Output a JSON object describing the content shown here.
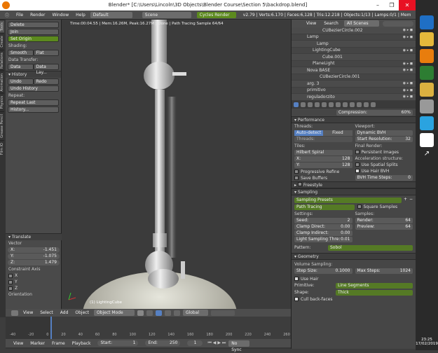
{
  "window": {
    "title": "Blender* [C:\\Users\\Lincoln\\3D Objects\\Blender Course\\Section 5\\backdrop.blend]"
  },
  "menubar": {
    "items": [
      "File",
      "Render",
      "Window",
      "Help"
    ],
    "layout": "Default",
    "scene": "Scene",
    "engine": "Cycles Render",
    "stats": "v2.79 | Verts:6.170 | Faces:6,128 | Tris:12.218 | Objects:1/13 | Lamps:0/1 | Mem"
  },
  "left_tabs": [
    "Tools",
    "Create",
    "Relations",
    "Animation",
    "Physics",
    "Grease Pencil",
    "Film IO"
  ],
  "tools": {
    "delete": "Delete",
    "join": "Join",
    "set_origin": "Set Origin",
    "shading_label": "Shading:",
    "smooth": "Smooth",
    "flat": "Flat",
    "data_transfer_label": "Data Transfer:",
    "data": "Data",
    "data_lay": "Data Lay...",
    "history_hd": "History",
    "undo": "Undo",
    "redo": "Redo",
    "undo_history": "Undo History",
    "repeat_label": "Repeat:",
    "repeat_last": "Repeat Last",
    "history": "History..."
  },
  "translate": {
    "hd": "Translate",
    "vector_label": "Vector",
    "x_label": "X:",
    "x": "-1.451",
    "y_label": "Y:",
    "y": "-1.075",
    "z_label": "Z:",
    "z": "1.479",
    "constraint_label": "Constraint Axis",
    "cx": "X",
    "cy": "Y",
    "cz": "Z",
    "orientation": "Orientation"
  },
  "viewport": {
    "info": "Time:00:04.55 | Mem:16.26M, Peak:16.27M | Done | Path Tracing Sample 64/64",
    "object": "(1) LightingCube"
  },
  "viewport_header": {
    "view": "View",
    "select": "Select",
    "add": "Add",
    "object": "Object",
    "mode": "Object Mode",
    "orientation": "Global"
  },
  "timeline": {
    "numbers": [
      "-40",
      "-20",
      "0",
      "20",
      "40",
      "60",
      "80",
      "100",
      "120",
      "140",
      "160",
      "180",
      "200",
      "220",
      "240",
      "260"
    ],
    "view": "View",
    "marker": "Marker",
    "frame": "Frame",
    "playback": "Playback",
    "start_label": "Start:",
    "start": "1",
    "end_label": "End:",
    "end": "250",
    "current": "1",
    "sync": "No Sync"
  },
  "outliner": {
    "view": "View",
    "search": "Search",
    "scenes": "All Scenes",
    "items": [
      "CUBezierCircle.002",
      "Lamp",
      "Lamp",
      "LightingCube",
      "Cube.001",
      "PlaneLight",
      "Nova BASE",
      "CUBezierCircle.001",
      "arg. 3",
      "primitivo",
      "reguladorzito"
    ]
  },
  "properties": {
    "compression_label": "Compression:",
    "compression": "60%",
    "performance_hd": "Performance",
    "threads_label": "Threads:",
    "auto_detect": "Auto-detect",
    "fixed": "Fixed",
    "threads": "Threads:",
    "viewport_label": "Viewport:",
    "viewport_bvh": "Dynamic BVH",
    "start_res_label": "Start Resolution:",
    "start_res": "32",
    "tiles_label": "Tiles:",
    "tiles": "Hilbert Spiral",
    "tx_label": "X:",
    "tx": "128",
    "ty_label": "Y:",
    "ty": "128",
    "final_render_label": "Final Render:",
    "persistent": "Persistent Images",
    "progressive": "Progressive Refine",
    "save_buffers": "Save Buffers",
    "accel_label": "Acceleration structure:",
    "spatial": "Use Spatial Splits",
    "hair_bvh": "Use Hair BVH",
    "bvh_steps_label": "BVH Time Steps:",
    "bvh_steps": "0",
    "freestyle_hd": "Freestyle",
    "sampling_hd": "Sampling",
    "presets": "Sampling Presets",
    "path_tracing": "Path Tracing",
    "square": "Square Samples",
    "settings_label": "Settings:",
    "samples_label": "Samples:",
    "seed_label": "Seed:",
    "seed": "2",
    "render_label": "Render:",
    "render": "64",
    "clamp_direct_label": "Clamp Direct:",
    "clamp_direct": "0.00",
    "preview_label": "Preview:",
    "preview": "64",
    "clamp_indirect_label": "Clamp Indirect:",
    "clamp_indirect": "0.00",
    "light_thr_label": "Light Sampling Thre:",
    "light_thr": "0.01",
    "pattern_label": "Pattern:",
    "pattern": "Sobol",
    "geometry_hd": "Geometry",
    "volume_label": "Volume Sampling:",
    "step_size_label": "Step Size:",
    "step_size": "0.1000",
    "max_steps_label": "Max Steps:",
    "max_steps": "1024",
    "use_hair": "Use Hair",
    "primitive_label": "Primitive:",
    "primitive": "Line Segments",
    "shape_label": "Shape:",
    "shape": "Thick",
    "cull": "Cull back-faces"
  },
  "taskbar": {
    "time": "23:25",
    "date": "17/02/2019"
  }
}
